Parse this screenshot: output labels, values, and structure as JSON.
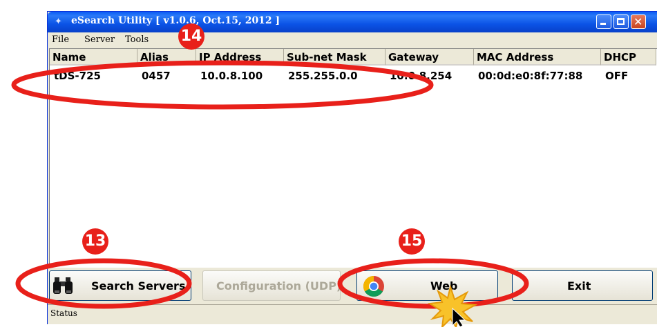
{
  "window": {
    "title": "eSearch Utility [ v1.0.6, Oct.15, 2012 ]"
  },
  "menu": {
    "file": "File",
    "server": "Server",
    "tools": "Tools"
  },
  "table": {
    "columns": [
      "Name",
      "Alias",
      "IP Address",
      "Sub-net Mask",
      "Gateway",
      "MAC Address",
      "DHCP"
    ],
    "rows": [
      {
        "name": "tDS-725",
        "alias": "0457",
        "ip": "10.0.8.100",
        "mask": "255.255.0.0",
        "gateway": "10.0.8.254",
        "mac": "00:0d:e0:8f:77:88",
        "dhcp": "OFF"
      }
    ]
  },
  "buttons": {
    "search": "Search Servers",
    "config": "Configuration (UDP)",
    "web": "Web",
    "exit": "Exit"
  },
  "status": {
    "text": "Status"
  },
  "annotations": {
    "step13": "13",
    "step14": "14",
    "step15": "15"
  },
  "colors": {
    "highlight_ring": "#e8201a",
    "titlebar": "#0b53e6",
    "starburst": "#f8c22a"
  },
  "icons": [
    "binoculars-icon",
    "chrome-icon",
    "app-icon",
    "minimize-icon",
    "maximize-icon",
    "close-icon",
    "cursor-icon",
    "starburst-icon"
  ]
}
